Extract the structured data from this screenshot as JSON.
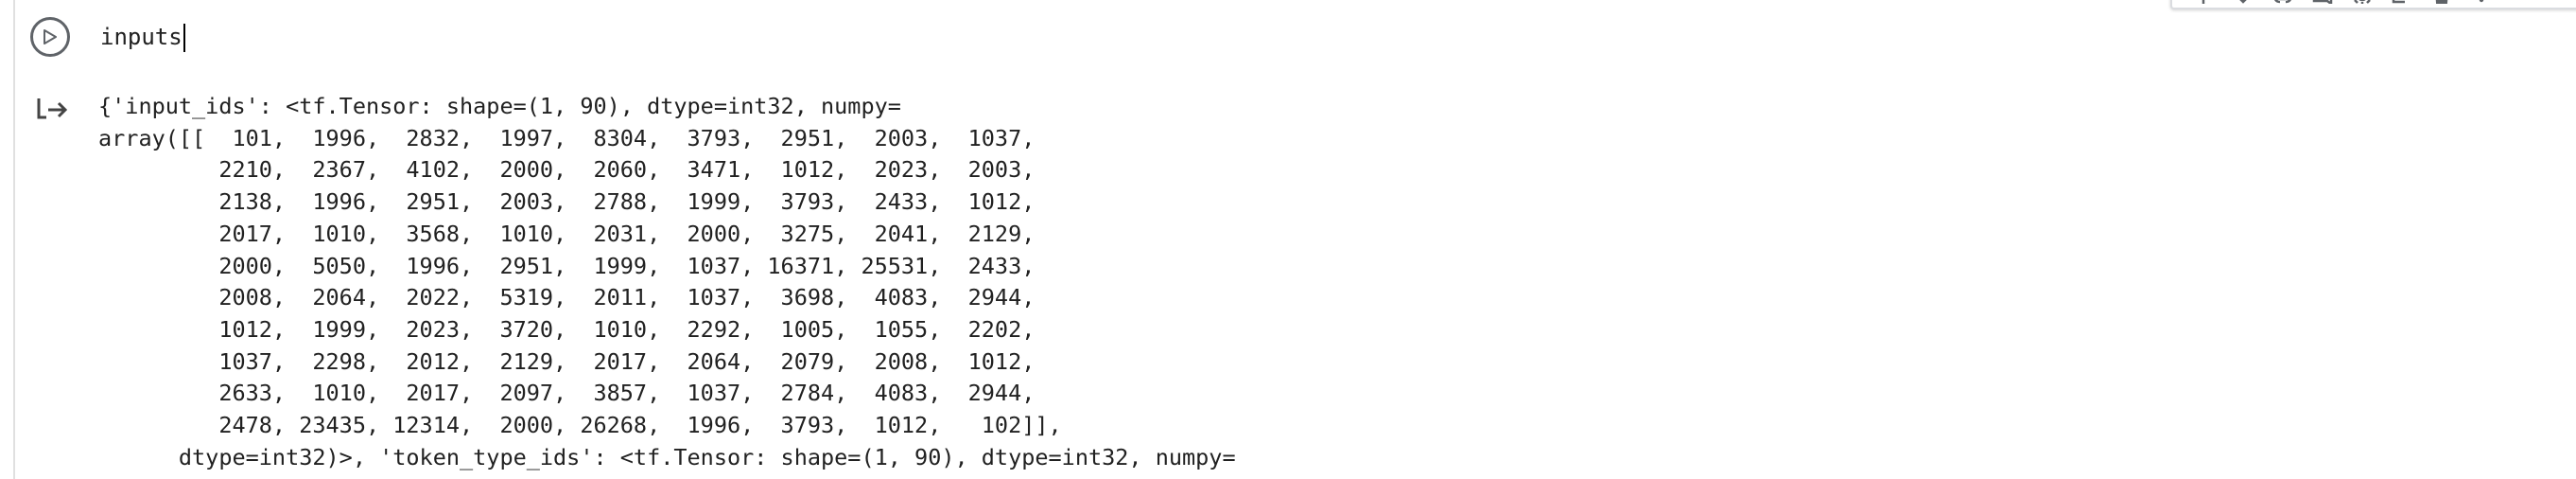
{
  "cell": {
    "run_button": "run-cell",
    "code": "inputs"
  },
  "toolbar": {
    "icons": [
      "arrow-up-icon",
      "arrow-down-icon",
      "link-icon",
      "comment-icon",
      "settings-icon",
      "mirror-cell-icon",
      "delete-icon",
      "more-icon"
    ]
  },
  "output": {
    "icon": "output-arrow-icon",
    "lines": [
      "{'input_ids': <tf.Tensor: shape=(1, 90), dtype=int32, numpy=",
      "array([[  101,  1996,  2832,  1997,  8304,  3793,  2951,  2003,  1037,",
      "         2210,  2367,  4102,  2000,  2060,  3471,  1012,  2023,  2003,",
      "         2138,  1996,  2951,  2003,  2788,  1999,  3793,  2433,  1012,",
      "         2017,  1010,  3568,  1010,  2031,  2000,  3275,  2041,  2129,",
      "         2000,  5050,  1996,  2951,  1999,  1037, 16371, 25531,  2433,",
      "         2008,  2064,  2022,  5319,  2011,  1037,  3698,  4083,  2944,",
      "         1012,  1999,  2023,  3720,  1010,  2292,  1005,  1055,  2202,",
      "         1037,  2298,  2012,  2129,  2017,  2064,  2079,  2008,  1012,",
      "         2633,  1010,  2017,  2097,  3857,  1037,  2784,  4083,  2944,",
      "         2478, 23435, 12314,  2000, 26268,  1996,  3793,  1012,   102]],",
      "      dtype=int32)>, 'token_type_ids': <tf.Tensor: shape=(1, 90), dtype=int32, numpy="
    ]
  }
}
